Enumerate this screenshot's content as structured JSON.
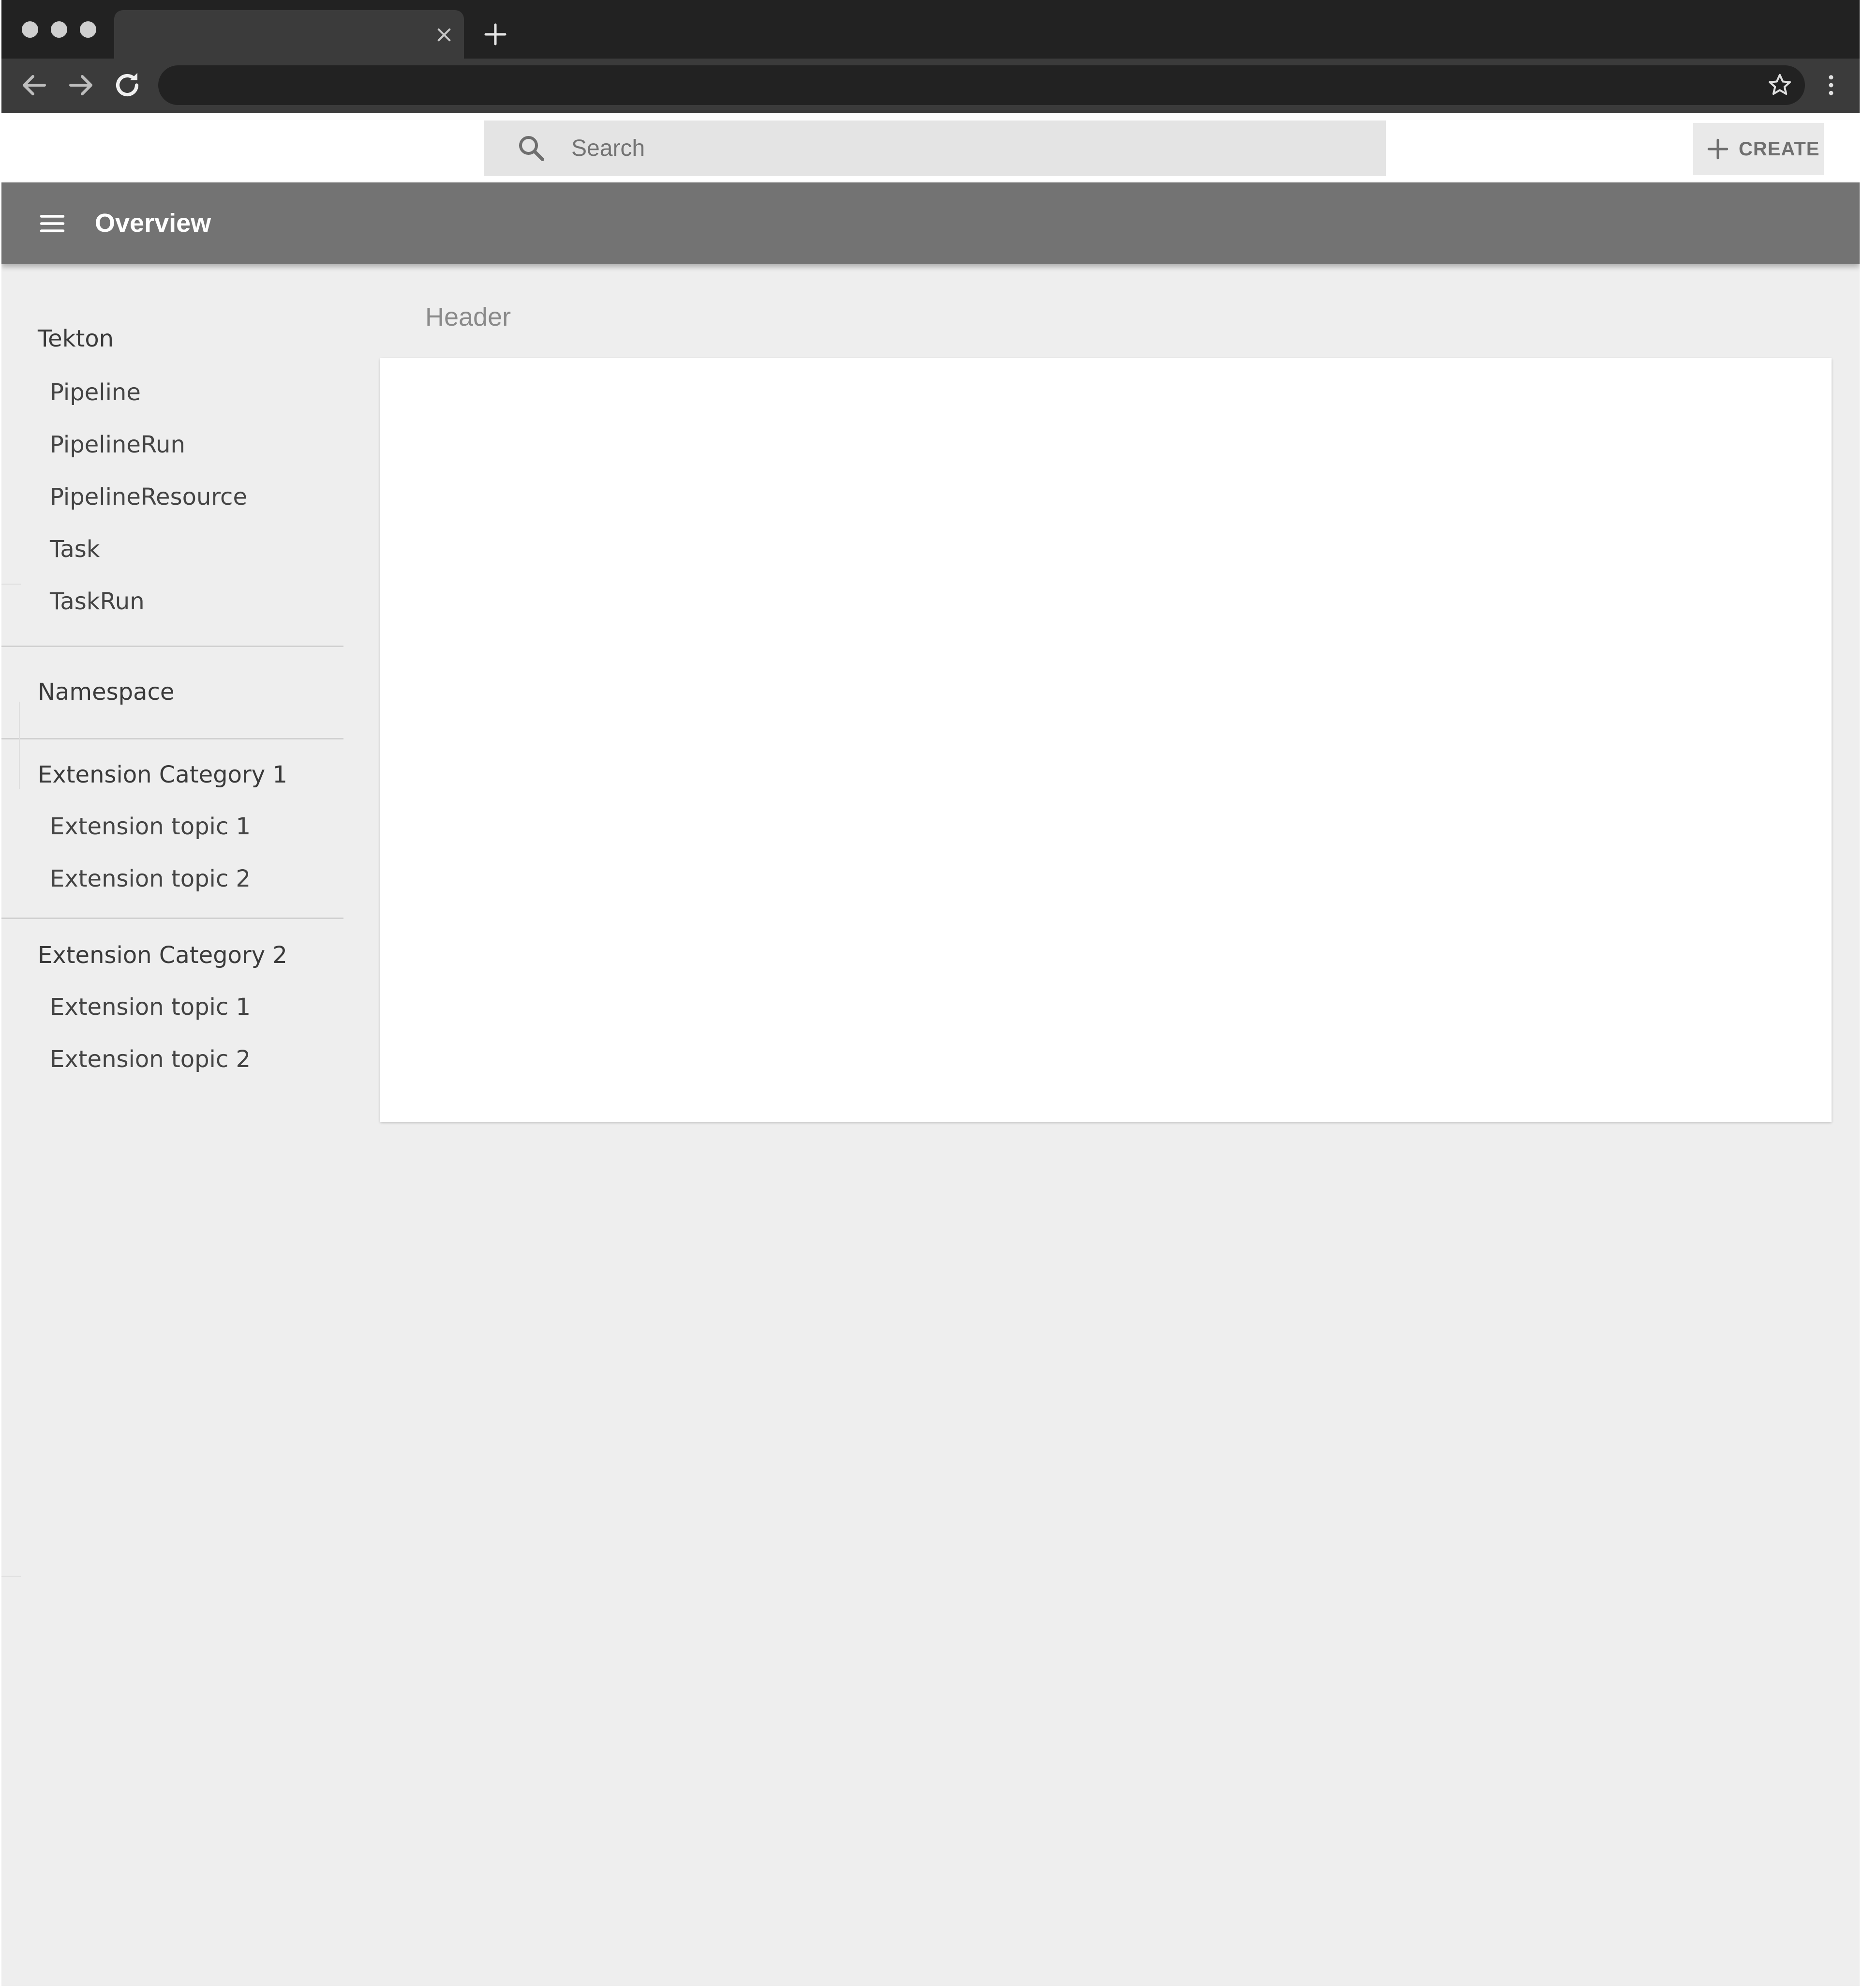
{
  "browser": {
    "tab_title": "",
    "address": "",
    "icons": {
      "close_tab": "close-icon",
      "new_tab": "plus-icon",
      "back": "arrow-left-icon",
      "forward": "arrow-right-icon",
      "reload": "reload-icon",
      "bookmark": "star-icon",
      "menu": "kebab-menu-icon"
    }
  },
  "topbar": {
    "search_placeholder": "Search",
    "search_value": "",
    "create_label": "CREATE",
    "search_icon": "search-icon",
    "create_icon": "plus-icon"
  },
  "header": {
    "title": "Overview",
    "menu_icon": "hamburger-menu-icon"
  },
  "sidebar": {
    "sections": [
      {
        "title": "Tekton",
        "items": [
          "Pipeline",
          "PipelineRun",
          "PipelineResource",
          "Task",
          "TaskRun"
        ]
      },
      {
        "title": "Namespace",
        "items": []
      },
      {
        "title": "Extension Category 1",
        "items": [
          "Extension topic 1",
          "Extension topic 2"
        ]
      },
      {
        "title": "Extension Category 2",
        "items": [
          "Extension topic 1",
          "Extension topic 2"
        ]
      }
    ]
  },
  "main": {
    "header": "Header"
  },
  "colors": {
    "browser_tabbar": "#222222",
    "browser_toolbar": "#3b3b3b",
    "header_bar": "#737373",
    "page_background": "#eeeeee",
    "search_background": "#e4e4e4",
    "card_background": "#ffffff"
  }
}
